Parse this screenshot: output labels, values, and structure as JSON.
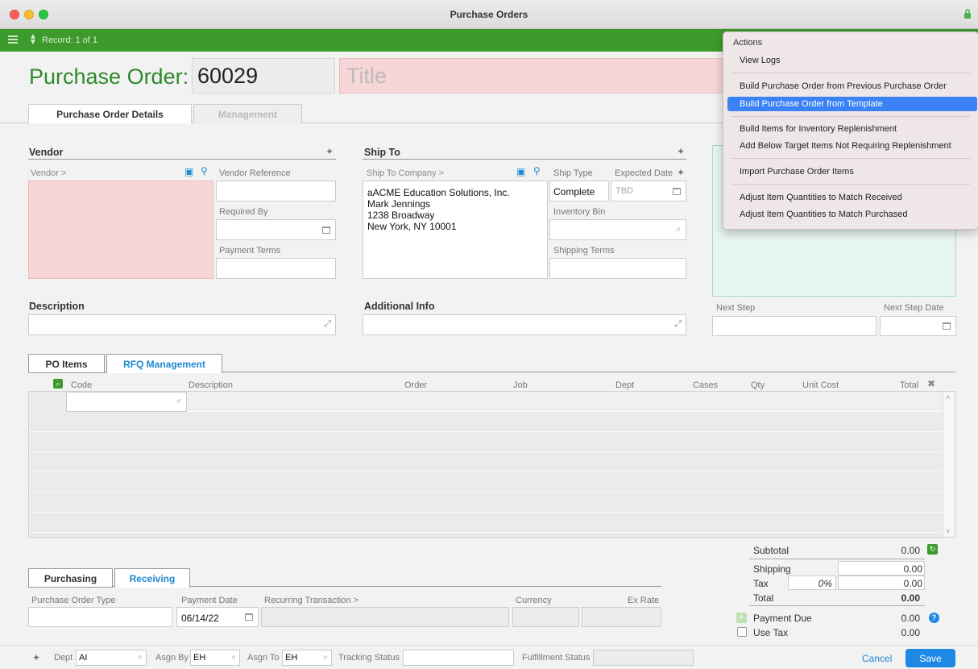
{
  "window": {
    "title": "Purchase Orders"
  },
  "toolbar": {
    "record_text": "Record: 1 of 1"
  },
  "header": {
    "label": "Purchase Order:",
    "number": "60029",
    "title_placeholder": "Title"
  },
  "main_tabs": [
    "Purchase Order Details",
    "Management"
  ],
  "vendor": {
    "section": "Vendor",
    "vendor_link": "Vendor >",
    "vendor_reference_label": "Vendor Reference",
    "required_by_label": "Required By",
    "payment_terms_label": "Payment Terms"
  },
  "ship_to": {
    "section": "Ship To",
    "company_link": "Ship To Company >",
    "address": [
      "aACME Education Solutions, Inc.",
      "Mark Jennings",
      "1238 Broadway",
      "New York, NY 10001"
    ],
    "ship_type_label": "Ship Type",
    "ship_type_value": "Complete",
    "expected_date_label": "Expected Date",
    "expected_date_value": "TBD",
    "inventory_bin_label": "Inventory Bin",
    "shipping_terms_label": "Shipping Terms"
  },
  "description": {
    "label": "Description"
  },
  "additional_info": {
    "label": "Additional Info"
  },
  "next_step": {
    "label": "Next Step",
    "date_label": "Next Step Date"
  },
  "item_tabs": [
    "PO Items",
    "RFQ Management"
  ],
  "grid": {
    "columns": [
      "Code",
      "Description",
      "Order",
      "Job",
      "Dept",
      "Cases",
      "Qty",
      "Unit Cost",
      "Total"
    ]
  },
  "bottom_tabs": [
    "Purchasing",
    "Receiving"
  ],
  "purchasing": {
    "type_label": "Purchase Order Type",
    "payment_date_label": "Payment Date",
    "payment_date_value": "06/14/22",
    "recurring_label": "Recurring Transaction >",
    "currency_label": "Currency",
    "ex_rate_label": "Ex Rate"
  },
  "totals": {
    "subtotal_label": "Subtotal",
    "subtotal": "0.00",
    "shipping_label": "Shipping",
    "shipping": "0.00",
    "tax_label": "Tax",
    "tax_rate": "0%",
    "tax": "0.00",
    "total_label": "Total",
    "total": "0.00",
    "payment_due_label": "Payment Due",
    "payment_due": "0.00",
    "use_tax_label": "Use Tax",
    "use_tax": "0.00"
  },
  "footer": {
    "dept_label": "Dept",
    "dept_value": "AI",
    "asgn_by_label": "Asgn By",
    "asgn_by_value": "EH",
    "asgn_to_label": "Asgn To",
    "asgn_to_value": "EH",
    "tracking_label": "Tracking Status",
    "fulfillment_label": "Fulfillment Status",
    "cancel": "Cancel",
    "save": "Save"
  },
  "actions_menu": {
    "header": "Actions",
    "items": [
      "View Logs",
      "Build Purchase Order from Previous Purchase Order",
      "Build Purchase Order from Template",
      "Build Items for Inventory Replenishment",
      "Add Below Target Items Not Requiring Replenishment",
      "Import Purchase Order Items",
      "Adjust Item Quantities to Match Received",
      "Adjust Item Quantities to Match Purchased"
    ],
    "highlighted_index": 2
  },
  "colors": {
    "accent_green": "#3d9a2c",
    "link_blue": "#1e88d0",
    "required_pink": "#f6d6d6"
  }
}
